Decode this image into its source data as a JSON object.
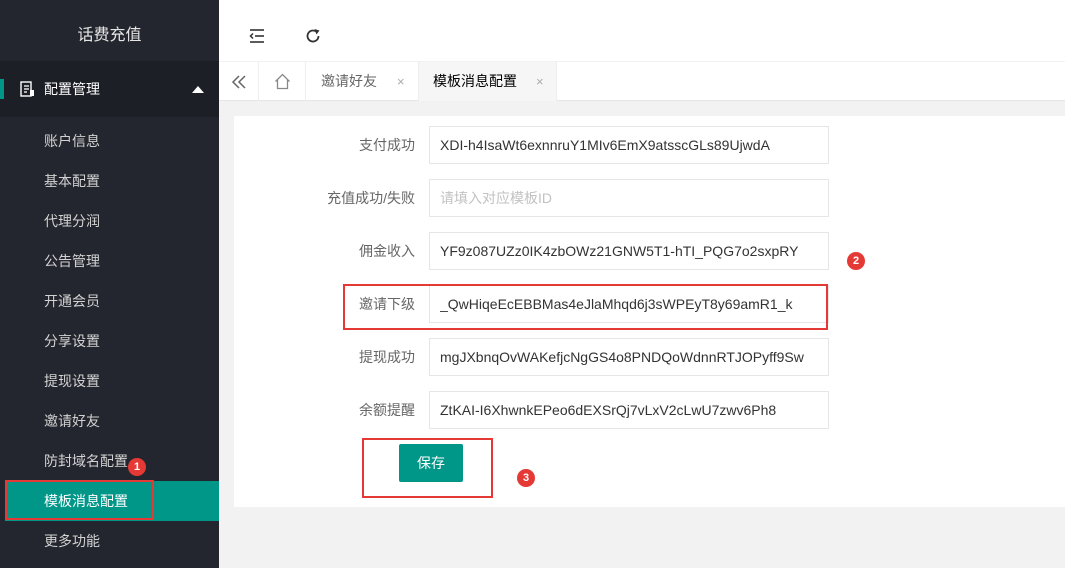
{
  "app": {
    "title": "话费充值"
  },
  "sidebar": {
    "section": {
      "label": "配置管理",
      "icon": "document-icon",
      "expanded": true
    },
    "items": [
      {
        "label": "账户信息"
      },
      {
        "label": "基本配置"
      },
      {
        "label": "代理分润"
      },
      {
        "label": "公告管理"
      },
      {
        "label": "开通会员"
      },
      {
        "label": "分享设置"
      },
      {
        "label": "提现设置"
      },
      {
        "label": "邀请好友"
      },
      {
        "label": "防封域名配置"
      },
      {
        "label": "模板消息配置",
        "active": true
      },
      {
        "label": "更多功能"
      }
    ]
  },
  "header": {
    "icons": [
      "menu-collapse-icon",
      "refresh-icon"
    ]
  },
  "tabs": {
    "items": [
      {
        "label": "邀请好友",
        "close": "×"
      },
      {
        "label": "模板消息配置",
        "close": "×",
        "active": true
      }
    ]
  },
  "form": {
    "fields": [
      {
        "label": "支付成功",
        "value": "XDI-h4IsaWt6exnnruY1MIv6EmX9atsscGLs89UjwdA",
        "placeholder": ""
      },
      {
        "label": "充值成功/失败",
        "value": "",
        "placeholder": "请填入对应模板ID"
      },
      {
        "label": "佣金收入",
        "value": "YF9z087UZz0IK4zbOWz21GNW5T1-hTI_PQG7o2sxpRY",
        "placeholder": ""
      },
      {
        "label": "邀请下级",
        "value": "_QwHiqeEcEBBMas4eJlaMhqd6j3sWPEyT8y69amR1_k",
        "placeholder": ""
      },
      {
        "label": "提现成功",
        "value": "mgJXbnqOvWAKefjcNgGS4o8PNDQoWdnnRTJOPyff9Sw",
        "placeholder": ""
      },
      {
        "label": "余额提醒",
        "value": "ZtKAI-I6XhwnkEPeo6dEXSrQj7vLxV2cLwU7zwv6Ph8",
        "placeholder": ""
      }
    ],
    "save_label": "保存"
  },
  "annotations": {
    "badges": [
      "1",
      "2",
      "3"
    ],
    "color": "#e53935"
  },
  "colors": {
    "accent": "#009688",
    "sidebar": "#23262e",
    "highlight": "#e53935"
  }
}
